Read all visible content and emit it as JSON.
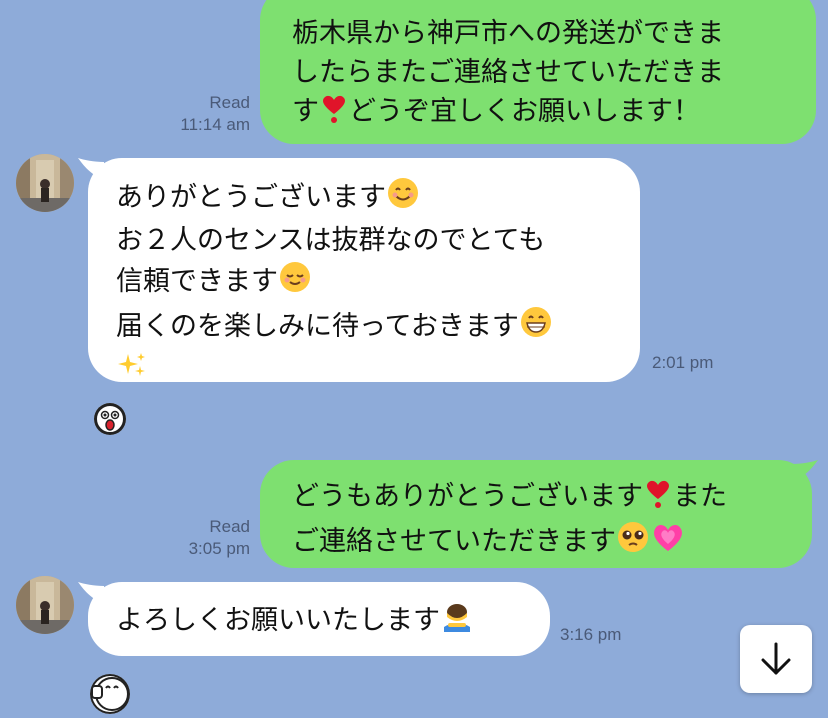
{
  "messages": [
    {
      "id": "m1",
      "direction": "outgoing",
      "lines": [
        "栃木県から神戸市への発送ができま",
        "したらまたご連絡させていただきま",
        "す",
        "どうぞ宜しくお願いします！"
      ],
      "read_label": "Read",
      "time": "11:14 am"
    },
    {
      "id": "m2",
      "direction": "incoming",
      "lines": [
        "ありがとうございます",
        "お２人のセンスは抜群なのでとても",
        "信頼できます",
        "届くのを楽しみに待っておきます"
      ],
      "time": "2:01 pm"
    },
    {
      "id": "m3",
      "direction": "incoming",
      "type": "sticker",
      "sticker": "surprised-face-sticker"
    },
    {
      "id": "m4",
      "direction": "outgoing",
      "lines": [
        "どうもありがとうございます",
        "また",
        "ご連絡させていただきます"
      ],
      "read_label": "Read",
      "time": "3:05 pm"
    },
    {
      "id": "m5",
      "direction": "incoming",
      "lines": [
        "よろしくお願いいたします"
      ],
      "time": "3:16 pm"
    },
    {
      "id": "m6",
      "direction": "incoming",
      "type": "sticker",
      "sticker": "thumbs-up-face-sticker"
    }
  ],
  "scroll_button": {
    "icon": "arrow-down-icon"
  },
  "colors": {
    "background": "#8eabd9",
    "outgoing_bubble": "#7ee070",
    "incoming_bubble": "#ffffff",
    "meta_text": "#4a5a78"
  }
}
